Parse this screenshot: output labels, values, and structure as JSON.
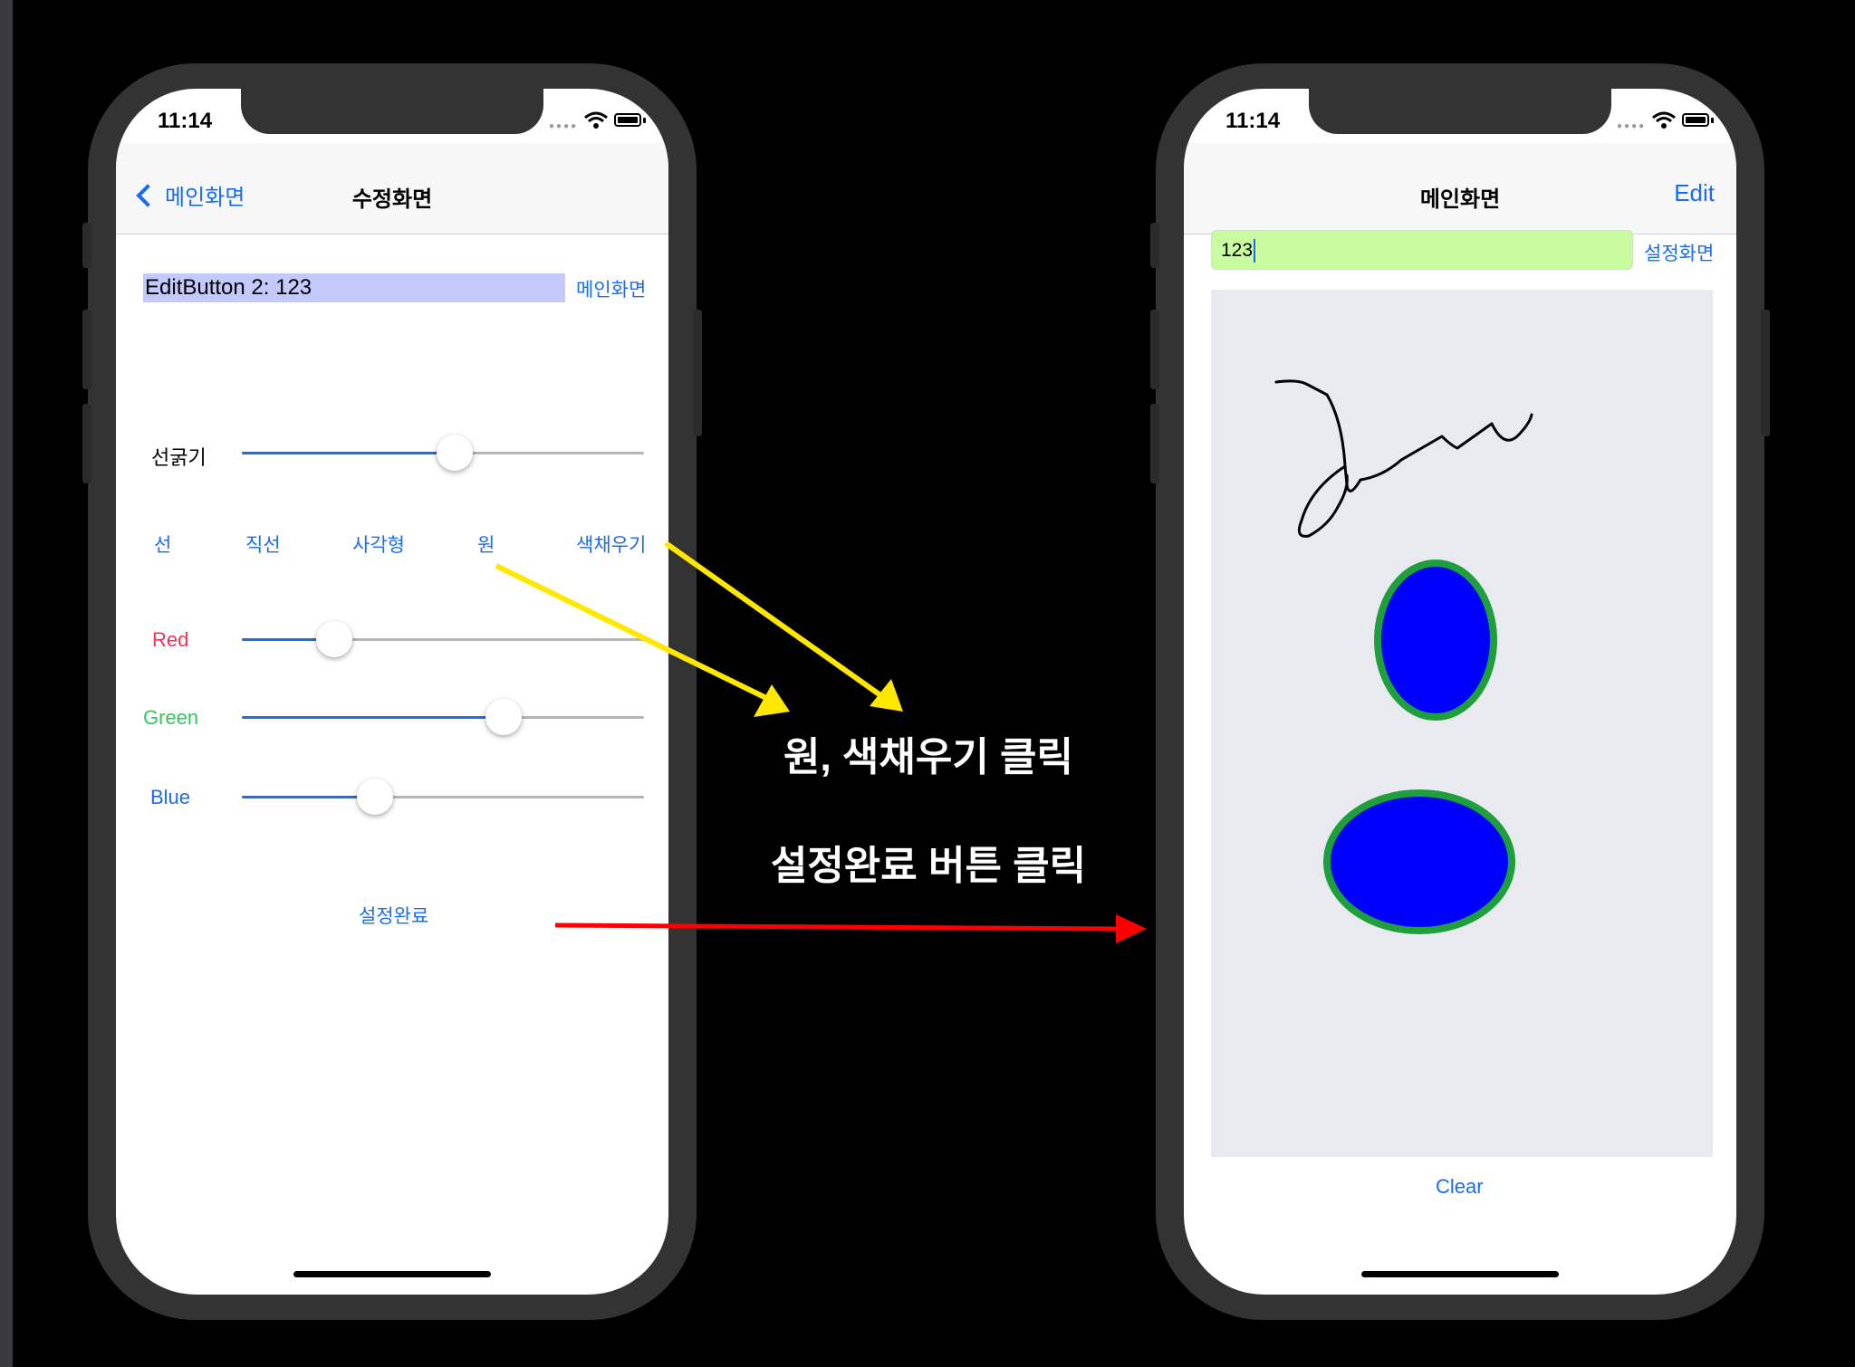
{
  "left_screen": {
    "status_time": "11:14",
    "nav_back_label": "메인화면",
    "nav_title": "수정화면",
    "text_field_value": "EditButton 2: 123",
    "main_screen_link": "메인화면",
    "line_width_label": "선굵기",
    "line_width_value": 0.53,
    "shape_buttons": [
      "선",
      "직선",
      "사각형",
      "원",
      "색채우기"
    ],
    "red_label": "Red",
    "red_value": 0.23,
    "green_label": "Green",
    "green_value": 0.65,
    "blue_label": "Blue",
    "blue_value": 0.33,
    "done_button": "설정완료"
  },
  "right_screen": {
    "status_time": "11:14",
    "nav_title": "메인화면",
    "edit_button": "Edit",
    "text_field_value": "123",
    "settings_link": "설정화면",
    "clear_button": "Clear",
    "shape_fill_color": "#0000ff",
    "shape_stroke_color": "#1f9e3c",
    "sketch_color": "#000000",
    "canvas_color": "#e9eaf0"
  },
  "annotations": {
    "step1": "원, 색채우기 클릭",
    "step2": "설정완료 버튼 클릭",
    "arrow_yellow_color": "#ffe800",
    "arrow_red_color": "#ff0000"
  },
  "colors": {
    "ios_blue": "#1a6bf5",
    "red_label_color": "#ff2d55",
    "green_label_color": "#34c759",
    "blue_label_color": "#1a6bf5"
  }
}
